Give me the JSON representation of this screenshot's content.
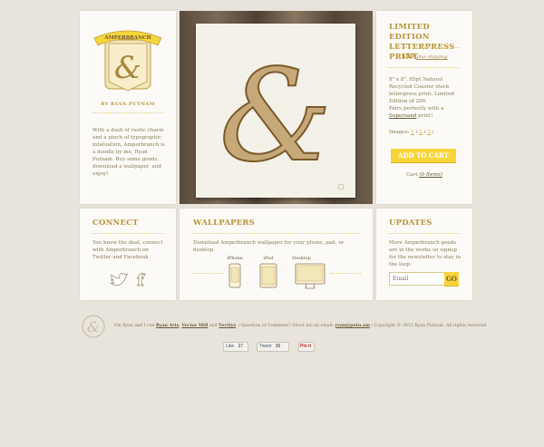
{
  "brand": {
    "banner": "AMPERBRANCH",
    "byline": "BY RYAN PUTNAM",
    "intro": "With a dash of rustic charm and a pinch of typographic infatuation, Amperbranch is a doodle by me, Ryan Putnam. Buy some goods, download a wallpaper, and enjoy!"
  },
  "product": {
    "title": "LIMITED EDITION LETTERPRESS PRINT",
    "price": "$20",
    "shipping": "plus shipping",
    "description": "8\" x 8\", 85pt Natural Recycled Coaster stock letterpress print. Limited Edition of 200.",
    "pairs_prefix": "Pairs perfectly with a",
    "pairs_link": "Supersand",
    "pairs_suffix": "print!",
    "images_label": "Images:",
    "image_links": [
      "1",
      "2",
      "3"
    ],
    "add_to_cart": "ADD TO CART",
    "cart_label": "Cart",
    "cart_count": "(0 Items)"
  },
  "connect": {
    "heading": "CONNECT",
    "text": "You know the deal, connect with Amperbranch on Twitter and Facebook"
  },
  "wallpapers": {
    "heading": "WALLPAPERS",
    "text": "Download Amperbranch wallpaper for your phone, pad, or desktop.",
    "devices": [
      {
        "label": "iPhone"
      },
      {
        "label": "iPad"
      },
      {
        "label": "Desktop"
      }
    ]
  },
  "updates": {
    "heading": "UPDATES",
    "text": "More Amperbranch goods are in the works so signup for the newsletter to stay in the loop.",
    "email_placeholder": "Email",
    "go": "GO"
  },
  "footer": {
    "intro": "I'm Ryan and I run",
    "links": [
      "Ryan Arts",
      "Vector Mill",
      "Vecttys"
    ],
    "and_text": "and",
    "question": "/ Question or Comment? Shoot me an email:",
    "email": "ryan@putn.am",
    "copyright": "/ Copyright © 2012 Ryan Putnam. All rights reserved"
  },
  "social": {
    "like_label": "Like",
    "like_count": "27",
    "tweet_label": "Tweet",
    "tweet_count": "36",
    "pin_label": "Pin it"
  },
  "colors": {
    "accent": "#f7d53a",
    "heading": "#b8943a",
    "background": "#e8e4dc"
  }
}
